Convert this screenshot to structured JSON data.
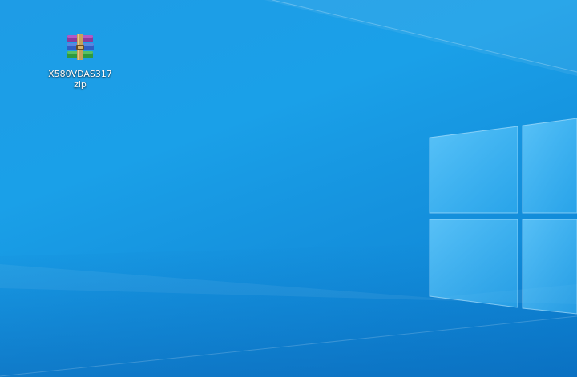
{
  "desktop": {
    "wallpaper": "windows-10-hero-wallpaper",
    "background_color": "#1a9be6",
    "icons": [
      {
        "label": "X580VDAS317zip",
        "icon": "winrar-archive-icon"
      }
    ]
  }
}
